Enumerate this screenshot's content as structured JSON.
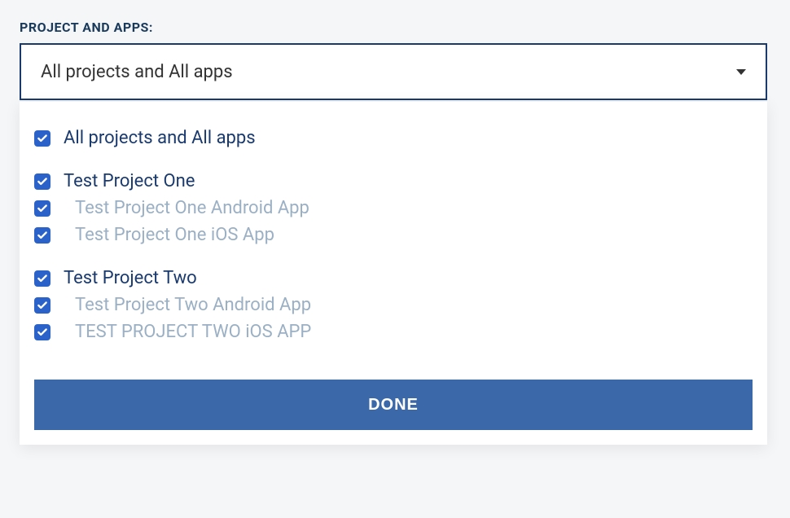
{
  "label": "PROJECT AND APPS:",
  "select": {
    "value": "All projects and All apps"
  },
  "options": {
    "all": {
      "label": "All projects and All apps",
      "checked": true
    },
    "groups": [
      {
        "name": "Test Project One",
        "checked": true,
        "apps": [
          {
            "name": "Test Project One Android App",
            "checked": true
          },
          {
            "name": "Test Project One iOS App",
            "checked": true
          }
        ]
      },
      {
        "name": "Test Project Two",
        "checked": true,
        "apps": [
          {
            "name": "Test Project Two Android App",
            "checked": true
          },
          {
            "name": "TEST PROJECT TWO iOS APP",
            "checked": true
          }
        ]
      }
    ]
  },
  "done_label": "DONE",
  "colors": {
    "primary": "#3a68a8",
    "checkbox": "#2a62c9",
    "border": "#1a3a6e",
    "text_main": "#1a3a6e",
    "text_muted": "#9bb0c4"
  }
}
